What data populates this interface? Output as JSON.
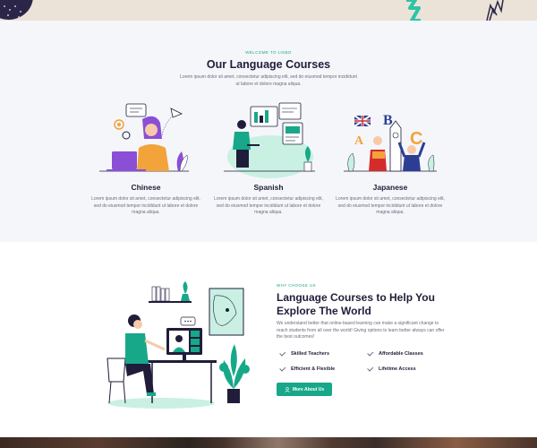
{
  "courses_section": {
    "eyebrow": "WELCOME TO LISBO",
    "title": "Our Language Courses",
    "intro": "Lorem ipsum dolor sit amet, consectetur adipiscing elit, sed do eiusmod tempor incididunt ut labore et dolore magna aliqua.",
    "cards": [
      {
        "title": "Chinese",
        "text": "Lorem ipsum dolor sit amet, consectetur adipiscing elit, sed do eiusmod tempor incididunt ut labore et dolore magna aliqua."
      },
      {
        "title": "Spanish",
        "text": "Lorem ipsum dolor sit amet, consectetur adipiscing elit, sed do eiusmod tempor incididunt ut labore et dolore magna aliqua."
      },
      {
        "title": "Japanese",
        "text": "Lorem ipsum dolor sit amet, consectetur adipiscing elit, sed do eiusmod tempor incididunt ut labore et dolore magna aliqua."
      }
    ]
  },
  "why_section": {
    "eyebrow": "WHY CHOOSE US",
    "title": "Language Courses to Help You Explore The World",
    "description": "We understand better that online-based learning can make a significant change to reach students from all over the world! Giving options to learn better always can offer the best outcomes!",
    "features": [
      "Skilled Teachers",
      "Affordable Classes",
      "Efficient & Flexible",
      "Lifetime Access"
    ],
    "button_label": "More About Us",
    "button_icon": "user-icon"
  },
  "colors": {
    "accent": "#17a889",
    "heading": "#1f1d3a",
    "section_bg": "#f5f6fa",
    "top_strip_bg": "#ebe3d8"
  }
}
